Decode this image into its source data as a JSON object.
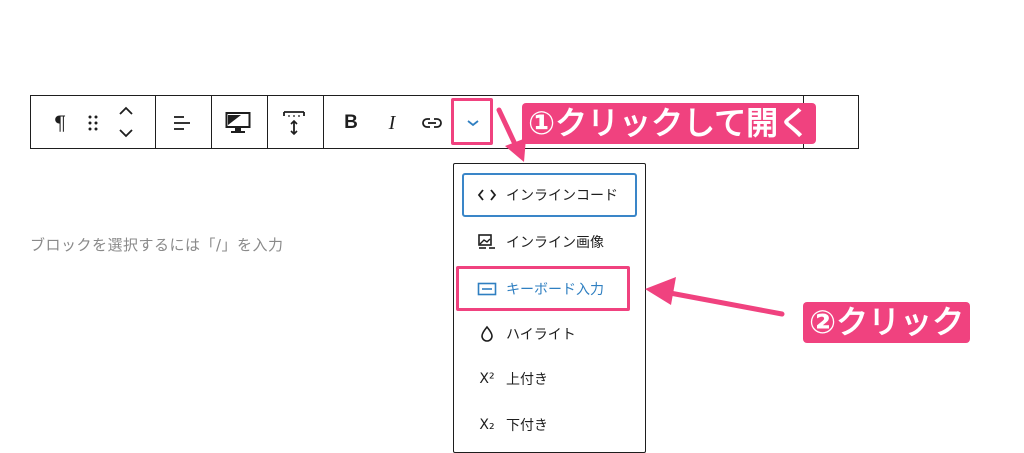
{
  "toolbar": {
    "paragraph_glyph": "¶",
    "bold_label": "B",
    "italic_label": "I",
    "icons": [
      "paragraph-icon",
      "drag-handle-icon",
      "move-up-icon",
      "move-down-icon",
      "align-left-icon",
      "desktop-icon",
      "block-spacing-icon",
      "link-icon",
      "chevron-down-icon"
    ]
  },
  "editor": {
    "placeholder": "ブロックを選択するには「/」を入力"
  },
  "dropdown": {
    "items": [
      {
        "label": "インラインコード",
        "icon": "code-icon"
      },
      {
        "label": "インライン画像",
        "icon": "image-icon"
      },
      {
        "label": "キーボード入力",
        "icon": "keyboard-icon"
      },
      {
        "label": "ハイライト",
        "icon": "droplet-icon"
      },
      {
        "label": "上付き",
        "icon": "superscript-icon",
        "glyph": "X²"
      },
      {
        "label": "下付き",
        "icon": "subscript-icon",
        "glyph": "X₂"
      }
    ]
  },
  "annotations": {
    "step1": "①クリックして開く",
    "step2": "②クリック"
  },
  "colors": {
    "annotation_pink": "#f0427f",
    "focus_blue": "#3a86c8",
    "highlight_text": "#2f7fc1"
  }
}
